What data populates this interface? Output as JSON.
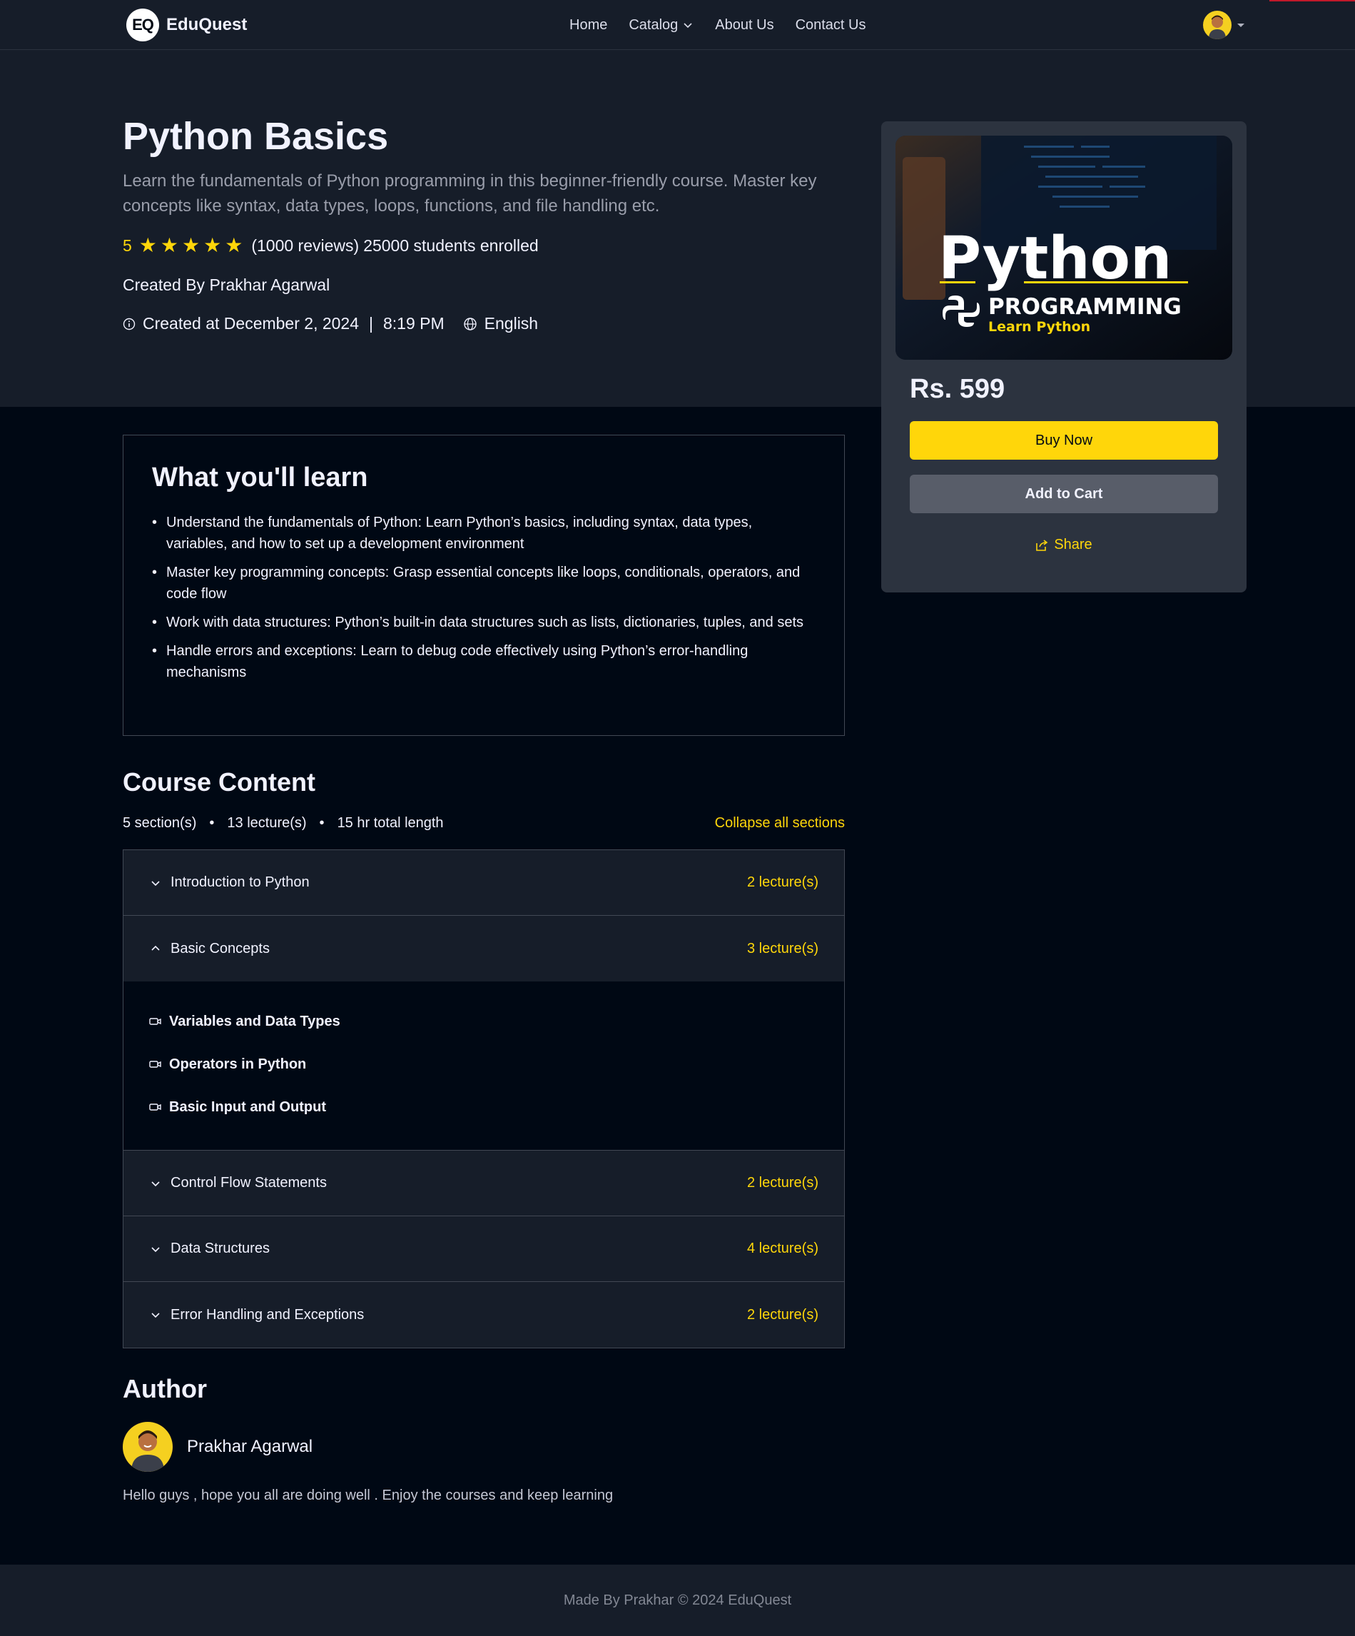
{
  "nav": {
    "logo_badge": "EQ",
    "logo_text": "EduQuest",
    "links": [
      "Home",
      "Catalog",
      "About Us",
      "Contact Us"
    ]
  },
  "course": {
    "title": "Python Basics",
    "description": "Learn the fundamentals of Python programming in this beginner-friendly course. Master key concepts like syntax, data types, loops, functions, and file handling etc.",
    "rating": "5",
    "stars": 5,
    "reviews": "(1000 reviews)",
    "enrolled": "25000 students enrolled",
    "created_by": "Created By Prakhar Agarwal",
    "created_at": "Created at December 2, 2024",
    "created_time": "8:19 PM",
    "language": "English"
  },
  "card": {
    "thumb_title": "Python",
    "thumb_sub": "PROGRAMMING",
    "thumb_tag": "Learn Python",
    "price": "Rs. 599",
    "buy_label": "Buy Now",
    "cart_label": "Add to Cart",
    "share_label": "Share"
  },
  "learn": {
    "title": "What you'll learn",
    "items": [
      "Understand the fundamentals of Python: Learn Python’s basics, including syntax, data types, variables, and how to set up a development environment",
      "Master key programming concepts: Grasp essential concepts like loops, conditionals, operators, and code flow",
      "Work with data structures: Python’s built-in data structures such as lists, dictionaries, tuples, and sets",
      "Handle errors and exceptions: Learn to debug code effectively using Python’s error-handling mechanisms"
    ]
  },
  "content": {
    "title": "Course Content",
    "sections_count": "5 section(s)",
    "lectures_count": "13 lecture(s)",
    "total_length": "15 hr total length",
    "collapse_label": "Collapse all sections",
    "sections": [
      {
        "name": "Introduction to Python",
        "lectures": "2 lecture(s)",
        "open": false
      },
      {
        "name": "Basic Concepts",
        "lectures": "3 lecture(s)",
        "open": true,
        "items": [
          "Variables and Data Types",
          "Operators in Python",
          "Basic Input and Output"
        ]
      },
      {
        "name": "Control Flow Statements",
        "lectures": "2 lecture(s)",
        "open": false
      },
      {
        "name": "Data Structures",
        "lectures": "4 lecture(s)",
        "open": false
      },
      {
        "name": "Error Handling and Exceptions",
        "lectures": "2 lecture(s)",
        "open": false
      }
    ]
  },
  "author": {
    "title": "Author",
    "name": "Prakhar Agarwal",
    "bio": "Hello guys , hope you all are doing well . Enjoy the courses and keep learning"
  },
  "footer": {
    "text": "Made By Prakhar © 2024 EduQuest"
  },
  "colors": {
    "accent": "#ffd60a",
    "bg": "#000814",
    "panel": "#161d29",
    "card": "#2c333f"
  }
}
